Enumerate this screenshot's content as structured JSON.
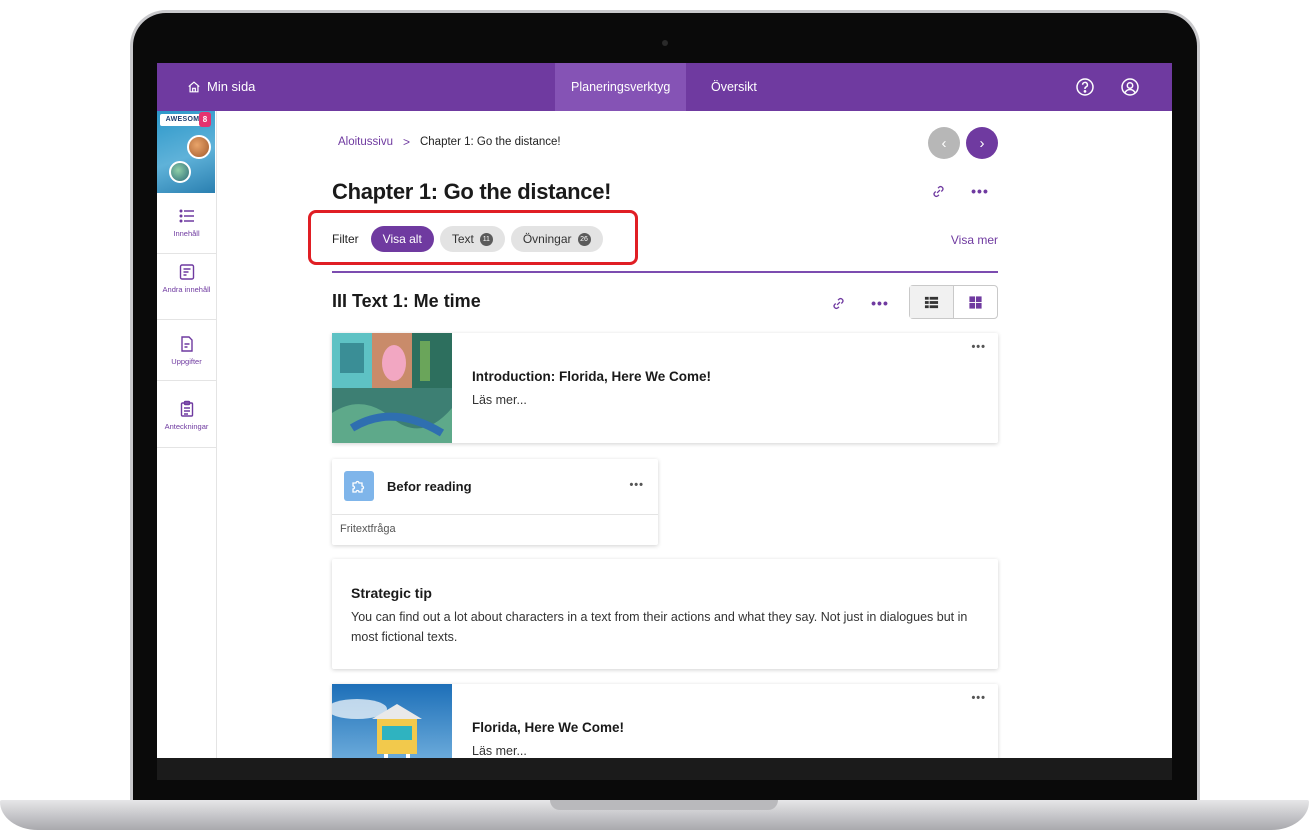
{
  "topbar": {
    "home_label": "Min sida",
    "tabs": [
      {
        "label": "Planeringsverktyg",
        "active": true
      },
      {
        "label": "Översikt",
        "active": false
      }
    ],
    "help_icon": "question-circle-icon",
    "user_icon": "user-circle-icon"
  },
  "sidebar": {
    "book_cover": {
      "title": "AWESOME",
      "badge": "8"
    },
    "items": [
      {
        "label": "Innehåll",
        "icon": "list-icon"
      },
      {
        "label": "Andra innehåll",
        "icon": "edit-list-icon"
      },
      {
        "label": "Uppgifter",
        "icon": "document-edit-icon"
      },
      {
        "label": "Anteckningar",
        "icon": "clipboard-icon"
      }
    ]
  },
  "breadcrumb": {
    "root": "Aloitussivu",
    "separator": ">",
    "current": "Chapter 1: Go the distance!"
  },
  "pager": {
    "prev": "‹",
    "next": "›"
  },
  "page": {
    "title": "Chapter 1: Go the distance!"
  },
  "filter": {
    "label": "Filter",
    "chips": [
      {
        "label": "Visa alt",
        "active": true
      },
      {
        "label": "Text",
        "count": "11",
        "active": false
      },
      {
        "label": "Övningar",
        "count": "26",
        "active": false
      }
    ],
    "show_more": "Visa mer"
  },
  "section": {
    "title": "III Text 1: Me time"
  },
  "cards": {
    "intro": {
      "title": "Introduction: Florida, Here We Come!",
      "subtitle": "Läs mer..."
    },
    "exercise": {
      "title": "Befor reading",
      "type": "Fritextfråga"
    },
    "tip": {
      "title": "Strategic tip",
      "body": "You can find out a lot about characters in a text from their actions and what they say. Not just in dialogues but in most fictional texts."
    },
    "florida": {
      "title": "Florida, Here We Come!",
      "subtitle": "Läs mer..."
    }
  },
  "colors": {
    "brand": "#6f3aa0",
    "highlight": "#e01e24"
  }
}
